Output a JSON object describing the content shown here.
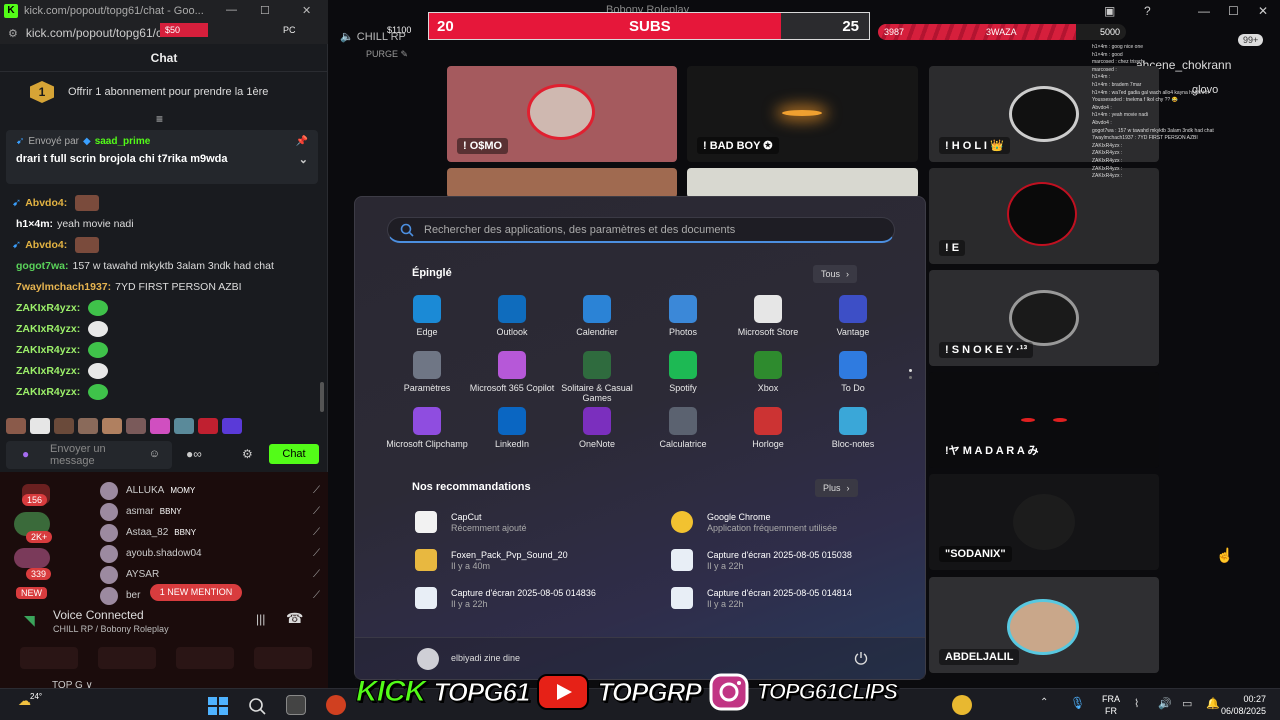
{
  "browser": {
    "title": "kick.com/popout/topg61/chat - Goo...",
    "url": "kick.com/popout/topg61/chat"
  },
  "chat": {
    "header": "Chat",
    "sub_goal_badge": "1",
    "sub_goal_text": "Offrir 1 abonnement pour prendre la 1ère",
    "pinned_by_label": "Envoyé par",
    "pinned_by_user": "saad_prime",
    "pinned_message": "drari t full scrin brojola chi t7rika m9wda",
    "messages": [
      {
        "user": "Abvdo4:",
        "text": "",
        "color": "#e3b342",
        "emote": "box"
      },
      {
        "user": "h1×4m:",
        "text": "yeah movie nadi",
        "color": "#ffffff",
        "emote": ""
      },
      {
        "user": "Abvdo4:",
        "text": "",
        "color": "#e3b342",
        "emote": "box"
      },
      {
        "user": "gogot7wa:",
        "text": "157 w tawahd mkyktb 3alam 3ndk had chat",
        "color": "#5ad35a",
        "emote": ""
      },
      {
        "user": "7waylmchach1937:",
        "text": "7YD FIRST PERSON AZBI",
        "color": "#e6b450",
        "emote": ""
      },
      {
        "user": "ZAKIxR4yzx:",
        "text": "",
        "color": "#9cf06a",
        "emote": "round"
      },
      {
        "user": "ZAKIxR4yzx:",
        "text": "",
        "color": "#9cf06a",
        "emote": "round"
      },
      {
        "user": "ZAKIxR4yzx:",
        "text": "",
        "color": "#9cf06a",
        "emote": "round"
      },
      {
        "user": "ZAKIxR4yzx:",
        "text": "",
        "color": "#9cf06a",
        "emote": "round"
      },
      {
        "user": "ZAKIxR4yzx:",
        "text": "",
        "color": "#9cf06a",
        "emote": "round"
      }
    ],
    "input_placeholder": "Envoyer un message",
    "send_label": "Chat",
    "accent": "#53fc18"
  },
  "discord": {
    "server_badges": [
      "156",
      "2K+",
      "339",
      "NEW"
    ],
    "members": [
      {
        "name": "ALLUKA",
        "tag": "MOMY"
      },
      {
        "name": "asmar",
        "tag": "BBNY"
      },
      {
        "name": "Astaa_82",
        "tag": "BBNY"
      },
      {
        "name": "ayoub.shadow04",
        "tag": ""
      },
      {
        "name": "AYSAR",
        "tag": ""
      },
      {
        "name": "ber",
        "tag": ""
      }
    ],
    "new_mention": "1 NEW MENTION",
    "voice_status": "Voice Connected",
    "voice_channel": "CHILL RP / Bobony Roleplay"
  },
  "stream": {
    "window_title": "Bobony Roleplay",
    "channel_label": "CHILL RP",
    "channel_sub": "PURGE",
    "subs_left": "20",
    "subs_title": "SUBS",
    "subs_right": "25",
    "subs_progress": 0.8,
    "money_left": "$50",
    "money_right": "$1100",
    "money_mid": "PC",
    "waza_left": "3987",
    "waza_title": "3WAZA",
    "waza_right": "5000",
    "waza_progress": 0.8,
    "badge_count": "99+"
  },
  "tiles": [
    {
      "name": "! O$MO"
    },
    {
      "name": "! BAD BOY ✪"
    },
    {
      "name": "! H O L I 👑"
    },
    {
      "name": "! E"
    },
    {
      "name": "! S N O K E Y ·¹³"
    },
    {
      "name": "!ヤ M A D A R A み"
    },
    {
      "name": "\"SODANIX\""
    },
    {
      "name": "ABDELJALIL"
    }
  ],
  "mini_chat": [
    "h1×4m : goog nice one",
    "h1×4m : good",
    "marcosed : chez trisyrh",
    "marcosed :",
    "h1×4m :",
    "h1×4m : bradem 7mar",
    "h1×4m : wa7ed gadia gal wach allo4 kayna hhhhhhh",
    "Youssesaded : tnekma f lkol chy ?? 😂",
    "Abvdo4 :",
    "h1×4m : yeah movie nadi",
    "Abvdo4 :",
    "gogot7wa : 157 w tawahd mkyktb 3alam 3ndk had chat",
    "7waylmchach1937 : 7YD FIRST PERSON AZBI",
    "ZAKIxR4yzx :",
    "ZAKIxR4yzx :",
    "ZAKIxR4yzx :",
    "ZAKIxR4yzx :",
    "ZAKIxR4yzx :"
  ],
  "overlay_names": [
    "ahcene_chokrann",
    "glovo"
  ],
  "start_menu": {
    "search_placeholder": "Rechercher des applications, des paramètres et des documents",
    "pinned_title": "Épinglé",
    "all_button": "Tous",
    "apps": [
      {
        "label": "Edge",
        "icon": "edge-icon",
        "color": "#1b8ad6"
      },
      {
        "label": "Outlook",
        "icon": "outlook-icon",
        "color": "#0f6cbd"
      },
      {
        "label": "Calendrier",
        "icon": "calendar-icon",
        "color": "#2b83d6"
      },
      {
        "label": "Photos",
        "icon": "photos-icon",
        "color": "#3b88d8"
      },
      {
        "label": "Microsoft Store",
        "icon": "store-icon",
        "color": "#e6e6e6"
      },
      {
        "label": "Vantage",
        "icon": "vantage-icon",
        "color": "#3d4fc6"
      },
      {
        "label": "Paramètres",
        "icon": "settings-icon",
        "color": "#6f7685"
      },
      {
        "label": "Microsoft 365 Copilot",
        "icon": "m365-icon",
        "color": "#b658d8"
      },
      {
        "label": "Solitaire & Casual Games",
        "icon": "solitaire-icon",
        "color": "#2f6b3e"
      },
      {
        "label": "Spotify",
        "icon": "spotify-icon",
        "color": "#1db954"
      },
      {
        "label": "Xbox",
        "icon": "xbox-icon",
        "color": "#2e8b2e"
      },
      {
        "label": "To Do",
        "icon": "todo-icon",
        "color": "#2f7be0"
      },
      {
        "label": "Microsoft Clipchamp",
        "icon": "clipchamp-icon",
        "color": "#8f4de0"
      },
      {
        "label": "LinkedIn",
        "icon": "linkedin-icon",
        "color": "#0a66c2"
      },
      {
        "label": "OneNote",
        "icon": "onenote-icon",
        "color": "#7b2fbe"
      },
      {
        "label": "Calculatrice",
        "icon": "calculator-icon",
        "color": "#5b6270"
      },
      {
        "label": "Horloge",
        "icon": "clock-icon",
        "color": "#cc3333"
      },
      {
        "label": "Bloc-notes",
        "icon": "notepad-icon",
        "color": "#3aa7d8"
      }
    ],
    "rec_title": "Nos recommandations",
    "more_button": "Plus",
    "recommendations": [
      {
        "title": "CapCut",
        "sub": "Récemment ajouté",
        "icon": "capcut-icon"
      },
      {
        "title": "Google Chrome",
        "sub": "Application fréquemment utilisée",
        "icon": "chrome-icon"
      },
      {
        "title": "Foxen_Pack_Pvp_Sound_20",
        "sub": "Il y a 40m",
        "icon": "folder-icon"
      },
      {
        "title": "Capture d'écran 2025-08-05 015038",
        "sub": "Il y a 22h",
        "icon": "image-file-icon"
      },
      {
        "title": "Capture d'écran 2025-08-05 014836",
        "sub": "Il y a 22h",
        "icon": "image-file-icon"
      },
      {
        "title": "Capture d'écran 2025-08-05 014814",
        "sub": "Il y a 22h",
        "icon": "image-file-icon"
      }
    ],
    "user_name": "elbiyadi zine dine"
  },
  "overlay_social": {
    "kick": "KICK",
    "kick_handle": "TOPG61",
    "youtube_handle": "TOPGRP",
    "instagram_handle": "TOPG61CLIPS"
  },
  "taskbar": {
    "weather_temp": "24°",
    "lang_1": "FRA",
    "lang_2": "FR",
    "time": "00:27",
    "date": "06/08/2025"
  }
}
